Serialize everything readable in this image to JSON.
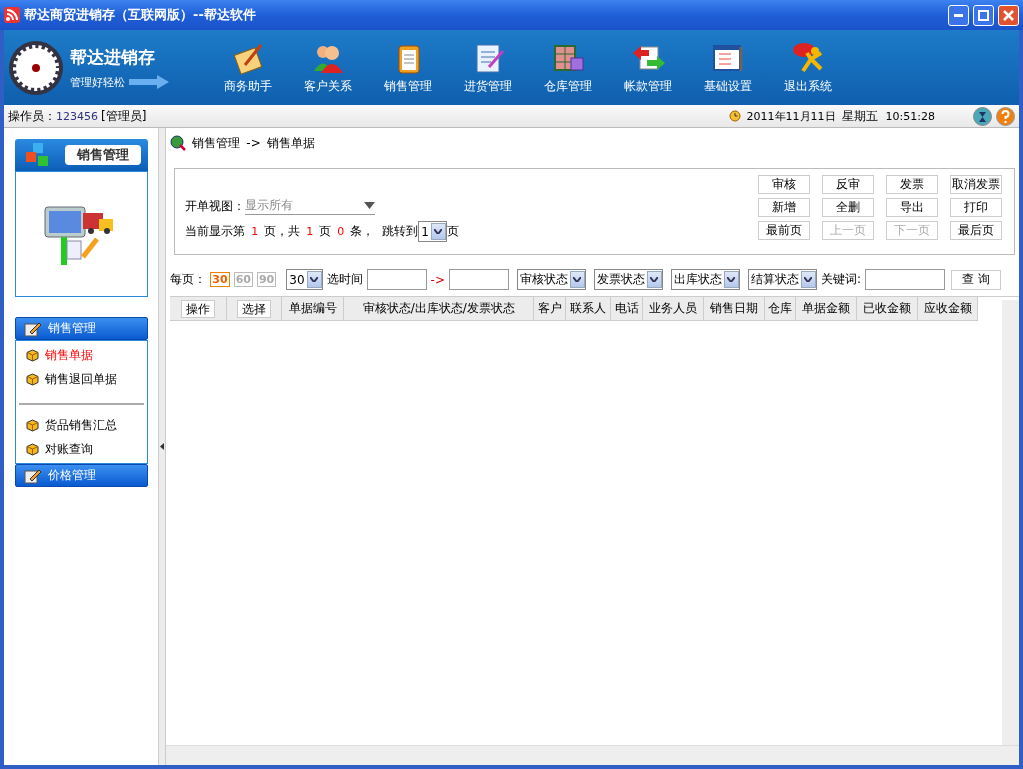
{
  "window": {
    "title": "帮达商贸进销存（互联网版）--帮达软件"
  },
  "banner": {
    "logo_title": "帮达进销存",
    "logo_slogan": "管理好轻松",
    "nav": [
      {
        "label": "商务助手"
      },
      {
        "label": "客户关系"
      },
      {
        "label": "销售管理"
      },
      {
        "label": "进货管理"
      },
      {
        "label": "仓库管理"
      },
      {
        "label": "帐款管理"
      },
      {
        "label": "基础设置"
      },
      {
        "label": "退出系统"
      }
    ]
  },
  "status_bar": {
    "operator_label": "操作员：",
    "operator_id": "123456",
    "operator_role": "[管理员]",
    "date": "2011年11月11日",
    "weekday": "星期五",
    "time": "10:51:28"
  },
  "sidebar": {
    "module_title": "销售管理",
    "groups": [
      {
        "title": "销售管理",
        "expanded": true,
        "sections": [
          {
            "items": [
              {
                "label": "销售单据",
                "selected": true
              },
              {
                "label": "销售退回单据",
                "selected": false
              }
            ]
          },
          {
            "items": [
              {
                "label": "货品销售汇总",
                "selected": false
              },
              {
                "label": "对账查询",
                "selected": false
              }
            ]
          }
        ]
      },
      {
        "title": "价格管理",
        "expanded": false
      }
    ]
  },
  "breadcrumb": {
    "path": "销售管理",
    "separator": "->",
    "current": "销售单据"
  },
  "filter_panel": {
    "view_label": "开单视图：",
    "view_placeholder": "显示所有",
    "pager": [
      {
        "kind": "text",
        "text": "当前显示第"
      },
      {
        "kind": "number",
        "text": "1"
      },
      {
        "kind": "text",
        "text": "页，共"
      },
      {
        "kind": "number",
        "text": "1"
      },
      {
        "kind": "text",
        "text": "页"
      },
      {
        "kind": "number",
        "text": "0"
      },
      {
        "kind": "text",
        "text": "条，"
      },
      {
        "kind": "text",
        "text": "跳转到"
      },
      {
        "kind": "select",
        "text": "1"
      },
      {
        "kind": "text",
        "text": "页"
      }
    ],
    "buttons": [
      {
        "label": "审核",
        "disabled": false
      },
      {
        "label": "反审",
        "disabled": false
      },
      {
        "label": "发票",
        "disabled": false
      },
      {
        "label": "取消发票",
        "disabled": false
      },
      {
        "label": "新增",
        "disabled": false
      },
      {
        "label": "全删",
        "disabled": false
      },
      {
        "label": "导出",
        "disabled": false
      },
      {
        "label": "打印",
        "disabled": false
      },
      {
        "label": "最前页",
        "disabled": false
      },
      {
        "label": "上一页",
        "disabled": true
      },
      {
        "label": "下一页",
        "disabled": true
      },
      {
        "label": "最后页",
        "disabled": false
      }
    ]
  },
  "toolbar": {
    "per_page_label": "每页：",
    "page_sizes": [
      {
        "label": "30",
        "selected": true
      },
      {
        "label": "60",
        "selected": false
      },
      {
        "label": "90",
        "selected": false
      }
    ],
    "page_size_select": "30",
    "time_label": "选时间",
    "time_separator": "->",
    "status_selects": [
      "审核状态",
      "发票状态",
      "出库状态",
      "结算状态"
    ],
    "keyword_label": "关键词:",
    "search_button": "查 询"
  },
  "table": {
    "columns": [
      {
        "label": "操作",
        "kind": "button"
      },
      {
        "label": "选择",
        "kind": "button"
      },
      {
        "label": "单据编号",
        "kind": "text"
      },
      {
        "label": "审核状态/出库状态/发票状态",
        "kind": "text"
      },
      {
        "label": "客户",
        "kind": "text"
      },
      {
        "label": "联系人",
        "kind": "text"
      },
      {
        "label": "电话",
        "kind": "text"
      },
      {
        "label": "业务人员",
        "kind": "text"
      },
      {
        "label": "销售日期",
        "kind": "text"
      },
      {
        "label": "仓库",
        "kind": "text"
      },
      {
        "label": "单据金额",
        "kind": "text"
      },
      {
        "label": "已收金额",
        "kind": "text"
      },
      {
        "label": "应收金额",
        "kind": "text"
      }
    ]
  }
}
